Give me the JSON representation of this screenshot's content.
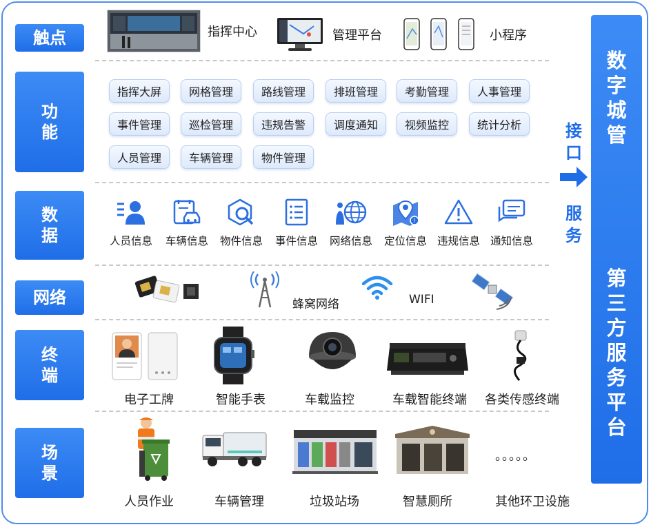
{
  "labels": {
    "touch": "触点",
    "function": [
      "功",
      "能"
    ],
    "data": [
      "数",
      "据"
    ],
    "network": "网络",
    "terminal": [
      "终",
      "端"
    ],
    "scene": [
      "场",
      "景"
    ]
  },
  "right_bar": {
    "top": [
      "数",
      "字",
      "城",
      "管"
    ],
    "bottom": [
      "第",
      "三",
      "方",
      "服",
      "务",
      "平",
      "台"
    ]
  },
  "interface": {
    "top": [
      "接",
      "口"
    ],
    "bottom": [
      "服",
      "务"
    ]
  },
  "touch_points": [
    "指挥中心",
    "管理平台",
    "小程序"
  ],
  "functions": [
    "指挥大屏",
    "网格管理",
    "路线管理",
    "排班管理",
    "考勤管理",
    "人事管理",
    "事件管理",
    "巡检管理",
    "违规告警",
    "调度通知",
    "视频监控",
    "统计分析",
    "人员管理",
    "车辆管理",
    "物件管理"
  ],
  "data_items": [
    {
      "label": "人员信息",
      "icon": "person-list-icon"
    },
    {
      "label": "车辆信息",
      "icon": "vehicle-doc-icon"
    },
    {
      "label": "物件信息",
      "icon": "object-search-icon"
    },
    {
      "label": "事件信息",
      "icon": "event-list-icon"
    },
    {
      "label": "网络信息",
      "icon": "network-globe-icon"
    },
    {
      "label": "定位信息",
      "icon": "location-map-icon"
    },
    {
      "label": "违规信息",
      "icon": "warning-icon"
    },
    {
      "label": "通知信息",
      "icon": "message-icon"
    }
  ],
  "network": {
    "cellular": "蜂窝网络",
    "wifi": "WIFI"
  },
  "terminals": [
    "电子工牌",
    "智能手表",
    "车载监控",
    "车载智能终端",
    "各类传感终端"
  ],
  "scenes": [
    "人员作业",
    "车辆管理",
    "垃圾站场",
    "智慧厕所",
    "其他环卫设施"
  ],
  "scene_dots": "。。。。。",
  "accent_color": "#1f6ee8"
}
